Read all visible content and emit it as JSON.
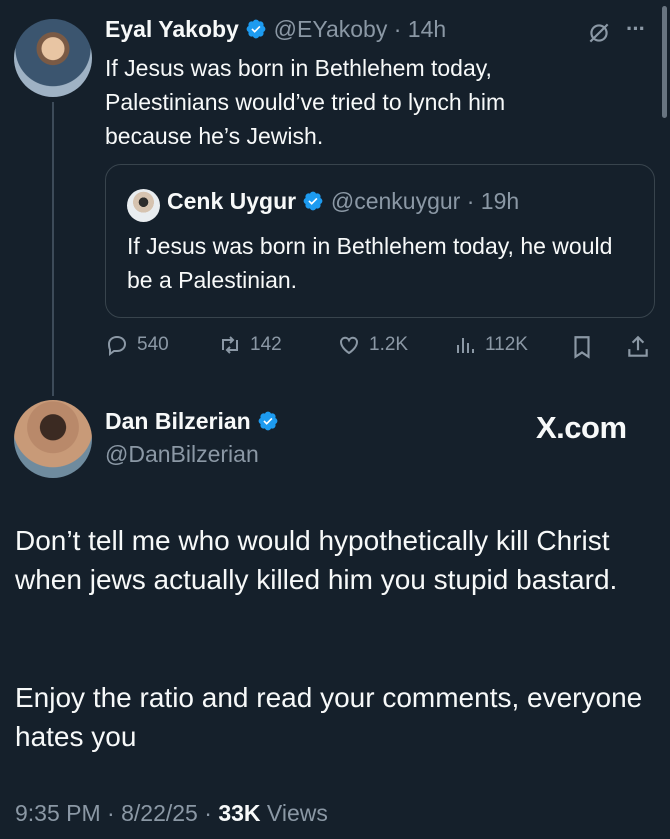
{
  "tweet1": {
    "name": "Eyal Yakoby",
    "handle": "@EYakoby",
    "sep": "·",
    "time": "14h",
    "text": "If Jesus was born in Bethlehem today, Palestinians would’ve tried to lynch him because he’s Jewish.",
    "more": "···"
  },
  "quote": {
    "name": "Cenk Uygur",
    "handle": "@cenkuygur",
    "sep": "·",
    "time": "19h",
    "text": "If Jesus was born in Bethlehem today, he would be a Palestinian."
  },
  "actions": {
    "replies": "540",
    "reposts": "142",
    "likes": "1.2K",
    "views": "112K"
  },
  "tweet2": {
    "name": "Dan Bilzerian",
    "handle": "@DanBilzerian",
    "watermark": "X.com",
    "text_p1": "Don’t tell me who would hypothetically kill Christ when jews actually killed him you stupid bastard.",
    "text_p2": "Enjoy the ratio and read your comments, everyone hates you",
    "time": "9:35 PM",
    "sep1": "·",
    "date": "8/22/25",
    "sep2": "·",
    "views_count": "33K",
    "views_label": "Views"
  },
  "colors": {
    "background": "#15202b",
    "text": "#f7f9f9",
    "muted": "#8b98a5",
    "verified": "#1d9bf0"
  }
}
